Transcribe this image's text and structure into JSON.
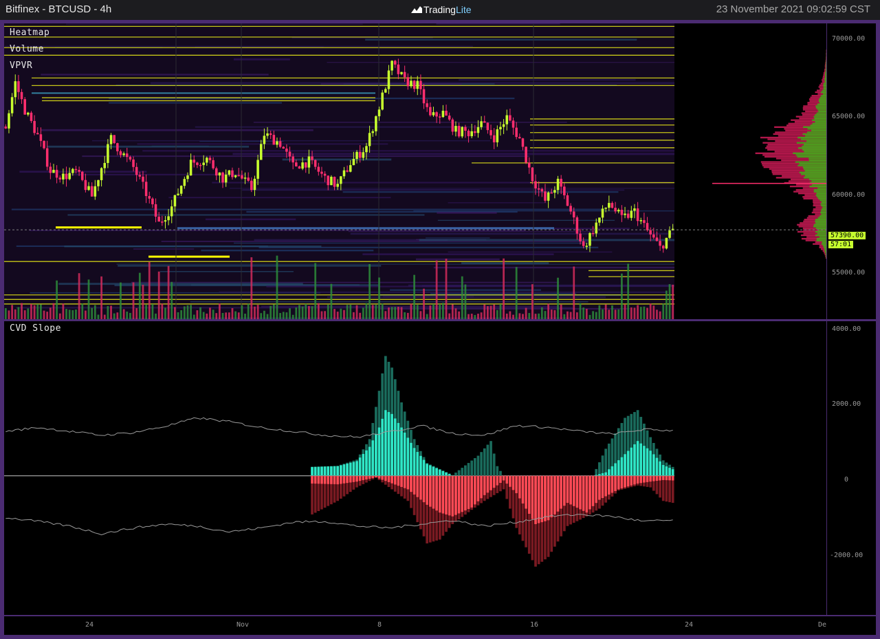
{
  "window": {
    "title": "Bitfinex - BTCUSD - 4h",
    "brand": "Trading",
    "brand_accent": "Lite",
    "timestamp": "23 November 2021 09:02:59 CST"
  },
  "overlays": [
    "Heatmap",
    "Volume",
    "VPVR"
  ],
  "lower_indicator": "CVD Slope",
  "colors": {
    "bull_candle": "#c8ff2e",
    "bear_candle": "#ff2e6e",
    "cvd_positive": "#2fe6c6",
    "cvd_negative": "#ff4a55",
    "vpvr_buy": "#4e9a1e",
    "vpvr_sell": "#b0174a",
    "heat_level": "#e6e617",
    "frame": "#4b2b72"
  },
  "current_price": {
    "price": "57390.00",
    "countdown": "57:01"
  },
  "chart_data": [
    {
      "type": "candlestick",
      "y_ticks": [
        "70000.00",
        "65000.00",
        "60000.00",
        "55000.00"
      ],
      "y_tick_values": [
        70000,
        65000,
        60000,
        55000
      ],
      "x_ticks": [
        "24",
        "Nov",
        "8",
        "16",
        "24",
        "De"
      ],
      "ylim": [
        51500,
        71000
      ],
      "close_path": [
        [
          0,
          64200
        ],
        [
          3,
          67100
        ],
        [
          6,
          65300
        ],
        [
          10,
          63600
        ],
        [
          14,
          61300
        ],
        [
          18,
          60900
        ],
        [
          22,
          61200
        ],
        [
          27,
          59600
        ],
        [
          33,
          63400
        ],
        [
          40,
          61500
        ],
        [
          44,
          59800
        ],
        [
          48,
          57800
        ],
        [
          52,
          58900
        ],
        [
          58,
          61800
        ],
        [
          63,
          62100
        ],
        [
          68,
          60800
        ],
        [
          72,
          61200
        ],
        [
          77,
          60100
        ],
        [
          81,
          63700
        ],
        [
          86,
          63100
        ],
        [
          90,
          61600
        ],
        [
          95,
          61900
        ],
        [
          100,
          60800
        ],
        [
          104,
          60300
        ],
        [
          108,
          61800
        ],
        [
          113,
          62900
        ],
        [
          117,
          65500
        ],
        [
          121,
          68300
        ],
        [
          125,
          67200
        ],
        [
          129,
          66900
        ],
        [
          133,
          64800
        ],
        [
          137,
          65100
        ],
        [
          141,
          63900
        ],
        [
          145,
          63800
        ],
        [
          149,
          64400
        ],
        [
          153,
          63500
        ],
        [
          157,
          64800
        ],
        [
          161,
          63400
        ],
        [
          165,
          60800
        ],
        [
          169,
          59300
        ],
        [
          173,
          60500
        ],
        [
          177,
          58600
        ],
        [
          181,
          56200
        ],
        [
          185,
          57800
        ],
        [
          189,
          59200
        ],
        [
          193,
          58100
        ],
        [
          197,
          58600
        ],
        [
          201,
          57300
        ],
        [
          205,
          56200
        ],
        [
          209,
          57390
        ]
      ]
    },
    {
      "type": "bar",
      "name": "CVD Slope",
      "y_ticks": [
        "4000.00",
        "2000.00",
        "0",
        "-2000.00"
      ],
      "y_tick_values": [
        4000,
        2000,
        0,
        -2000
      ],
      "ylim": [
        -3600,
        4000
      ],
      "bars_start_index": 96,
      "positive_outer": [
        [
          96,
          230
        ],
        [
          104,
          260
        ],
        [
          110,
          420
        ],
        [
          114,
          950
        ],
        [
          117,
          2200
        ],
        [
          119,
          3100
        ],
        [
          121,
          2800
        ],
        [
          124,
          1900
        ],
        [
          128,
          950
        ],
        [
          132,
          330
        ],
        [
          140,
          20
        ],
        [
          148,
          520
        ],
        [
          152,
          900
        ],
        [
          154,
          250
        ],
        [
          156,
          0
        ],
        [
          184,
          0
        ],
        [
          188,
          700
        ],
        [
          194,
          1500
        ],
        [
          198,
          1700
        ],
        [
          202,
          1000
        ],
        [
          206,
          400
        ],
        [
          209,
          230
        ]
      ],
      "positive_inner": [
        [
          96,
          230
        ],
        [
          104,
          250
        ],
        [
          110,
          380
        ],
        [
          114,
          750
        ],
        [
          117,
          1250
        ],
        [
          119,
          1700
        ],
        [
          121,
          1600
        ],
        [
          124,
          1250
        ],
        [
          128,
          720
        ],
        [
          132,
          310
        ],
        [
          140,
          10
        ],
        [
          148,
          0
        ],
        [
          184,
          0
        ],
        [
          188,
          90
        ],
        [
          194,
          560
        ],
        [
          198,
          900
        ],
        [
          202,
          650
        ],
        [
          206,
          280
        ],
        [
          209,
          170
        ]
      ],
      "negative_outer": [
        [
          96,
          -1000
        ],
        [
          104,
          -650
        ],
        [
          110,
          -300
        ],
        [
          116,
          -50
        ],
        [
          126,
          -650
        ],
        [
          132,
          -1750
        ],
        [
          136,
          -1650
        ],
        [
          140,
          -1250
        ],
        [
          146,
          -880
        ],
        [
          150,
          -650
        ],
        [
          156,
          -350
        ],
        [
          160,
          -1350
        ],
        [
          166,
          -2350
        ],
        [
          170,
          -2100
        ],
        [
          176,
          -1300
        ],
        [
          182,
          -1050
        ],
        [
          186,
          -850
        ],
        [
          192,
          -380
        ],
        [
          198,
          -250
        ],
        [
          202,
          -300
        ],
        [
          206,
          -650
        ],
        [
          209,
          -700
        ]
      ],
      "negative_inner": [
        [
          96,
          -200
        ],
        [
          104,
          -220
        ],
        [
          110,
          -150
        ],
        [
          116,
          -40
        ],
        [
          126,
          -350
        ],
        [
          132,
          -750
        ],
        [
          136,
          -950
        ],
        [
          140,
          -1050
        ],
        [
          146,
          -820
        ],
        [
          150,
          -500
        ],
        [
          156,
          -120
        ],
        [
          160,
          -450
        ],
        [
          166,
          -1250
        ],
        [
          170,
          -1150
        ],
        [
          176,
          -700
        ],
        [
          182,
          -950
        ],
        [
          186,
          -620
        ],
        [
          192,
          -350
        ],
        [
          198,
          -200
        ],
        [
          202,
          -150
        ],
        [
          206,
          -110
        ],
        [
          209,
          -120
        ]
      ],
      "upper_band": [
        [
          0,
          1150
        ],
        [
          10,
          1250
        ],
        [
          20,
          1150
        ],
        [
          30,
          1050
        ],
        [
          40,
          1120
        ],
        [
          50,
          1280
        ],
        [
          60,
          1500
        ],
        [
          70,
          1400
        ],
        [
          80,
          1250
        ],
        [
          90,
          1150
        ],
        [
          100,
          1050
        ],
        [
          110,
          1000
        ],
        [
          120,
          1130
        ],
        [
          130,
          1300
        ],
        [
          140,
          1100
        ],
        [
          150,
          1050
        ],
        [
          160,
          1300
        ],
        [
          170,
          1250
        ],
        [
          180,
          1150
        ],
        [
          190,
          1080
        ],
        [
          200,
          1200
        ],
        [
          209,
          1170
        ]
      ],
      "lower_band": [
        [
          0,
          -1080
        ],
        [
          10,
          -1180
        ],
        [
          20,
          -1300
        ],
        [
          30,
          -1500
        ],
        [
          40,
          -1350
        ],
        [
          50,
          -1250
        ],
        [
          60,
          -1300
        ],
        [
          70,
          -1450
        ],
        [
          80,
          -1350
        ],
        [
          90,
          -1200
        ],
        [
          100,
          -1180
        ],
        [
          110,
          -1300
        ],
        [
          120,
          -1350
        ],
        [
          130,
          -1250
        ],
        [
          140,
          -1150
        ],
        [
          150,
          -1300
        ],
        [
          160,
          -1200
        ],
        [
          170,
          -1050
        ],
        [
          180,
          -1000
        ],
        [
          190,
          -1050
        ],
        [
          200,
          -1180
        ],
        [
          209,
          -1150
        ]
      ]
    }
  ]
}
